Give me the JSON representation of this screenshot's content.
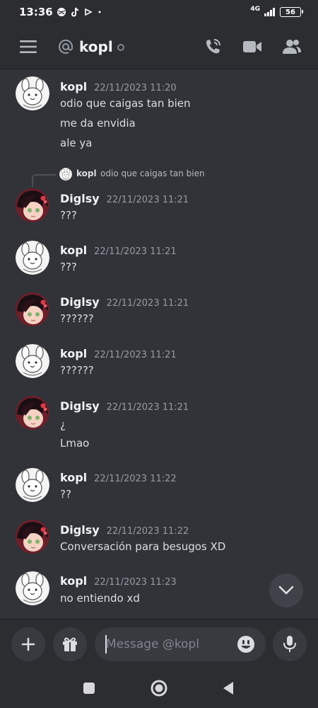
{
  "status_bar": {
    "time": "13:36",
    "network": "4G",
    "battery": "56"
  },
  "header": {
    "channel_name": "kopl"
  },
  "messages": [
    {
      "author": "kopl",
      "timestamp": "22/11/2023 11:20",
      "lines": [
        "odio que caigas tan bien",
        "me da envidia",
        "ale ya"
      ]
    },
    {
      "author": "Diglsy",
      "timestamp": "22/11/2023 11:21",
      "reply": {
        "author": "kopl",
        "text": "odio que caigas tan bien"
      },
      "lines": [
        "???"
      ]
    },
    {
      "author": "kopl",
      "timestamp": "22/11/2023 11:21",
      "lines": [
        "???"
      ]
    },
    {
      "author": "Diglsy",
      "timestamp": "22/11/2023 11:21",
      "lines": [
        "??????"
      ]
    },
    {
      "author": "kopl",
      "timestamp": "22/11/2023 11:21",
      "lines": [
        "??????"
      ]
    },
    {
      "author": "Diglsy",
      "timestamp": "22/11/2023 11:21",
      "lines": [
        "¿",
        "Lmao"
      ]
    },
    {
      "author": "kopl",
      "timestamp": "22/11/2023 11:22",
      "lines": [
        "??"
      ]
    },
    {
      "author": "Diglsy",
      "timestamp": "22/11/2023 11:22",
      "lines": [
        "Conversación para besugos XD"
      ]
    },
    {
      "author": "kopl",
      "timestamp": "22/11/2023 11:23",
      "lines": [
        "no entiendo xd"
      ]
    }
  ],
  "composer": {
    "placeholder": "Message @kopl"
  },
  "colors": {
    "background": "#313338",
    "header_bg": "#2b2d31",
    "text": "#dbdee1",
    "muted": "#949ba4",
    "button_bg": "#383a40"
  },
  "icons": {
    "menu": "hamburger-icon",
    "at": "at-sign-icon",
    "call": "phone-call-icon",
    "video": "video-camera-icon",
    "members": "members-icon",
    "scroll": "chevron-down-icon",
    "plus": "plus-icon",
    "gift": "gift-icon",
    "emoji": "emoji-icon",
    "mic": "microphone-icon"
  }
}
